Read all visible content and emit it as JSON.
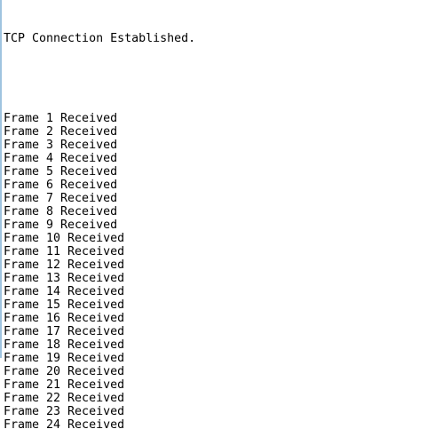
{
  "console": {
    "header": "TCP Connection Established.",
    "lines": [
      "Frame 1 Received",
      "Frame 2 Received",
      "Frame 3 Received",
      "Frame 4 Received",
      "Frame 5 Received",
      "Frame 6 Received",
      "Frame 7 Received",
      "Frame 8 Received",
      "Frame 9 Received",
      "Frame 10 Received",
      "Frame 11 Received",
      "Frame 12 Received",
      "Frame 13 Received",
      "Frame 14 Received",
      "Frame 15 Received",
      "Frame 16 Received",
      "Frame 17 Received",
      "Frame 18 Received",
      "Frame 19 Received",
      "Frame 20 Received",
      "Frame 21 Received",
      "Frame 22 Received",
      "Frame 23 Received",
      "Frame 24 Received"
    ]
  }
}
